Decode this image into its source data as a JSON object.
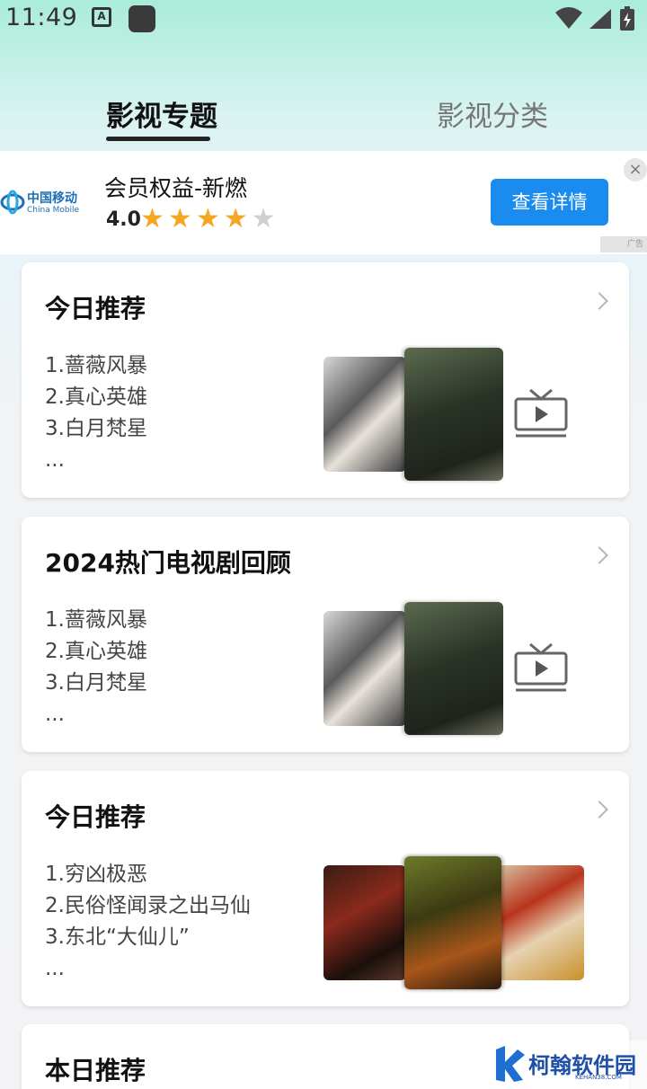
{
  "status_bar": {
    "time": "11:49",
    "icons": [
      "notification-a-icon",
      "app-square-icon",
      "wifi-icon",
      "signal-icon",
      "battery-charging-icon"
    ]
  },
  "tabs": [
    {
      "label": "影视专题",
      "active": true
    },
    {
      "label": "影视分类",
      "active": false
    }
  ],
  "ad": {
    "brand": "中国移动",
    "brand_en": "China Mobile",
    "title": "会员权益-新燃",
    "rating": "4.0",
    "stars_filled": 4,
    "stars_total": 5,
    "button": "查看详情",
    "close": "×",
    "tag": "广告"
  },
  "cards": [
    {
      "title": "今日推荐",
      "items": [
        "1.蔷薇风暴",
        "2.真心英雄",
        "3.白月梵星",
        "..."
      ]
    },
    {
      "title": "2024热门电视剧回顾",
      "items": [
        "1.蔷薇风暴",
        "2.真心英雄",
        "3.白月梵星",
        "..."
      ]
    },
    {
      "title": "今日推荐",
      "items": [
        "1.穷凶极恶",
        "2.民俗怪闻录之出马仙",
        "3.东北“大仙儿”",
        "..."
      ]
    },
    {
      "title": "本日推荐",
      "items": []
    }
  ],
  "watermark": {
    "name": "柯翰软件园",
    "domain": "KEHAN38.COM"
  },
  "colors": {
    "accent_blue": "#1a8cf0",
    "star": "#f5a623",
    "bg_mint": "#a9ecd9"
  }
}
